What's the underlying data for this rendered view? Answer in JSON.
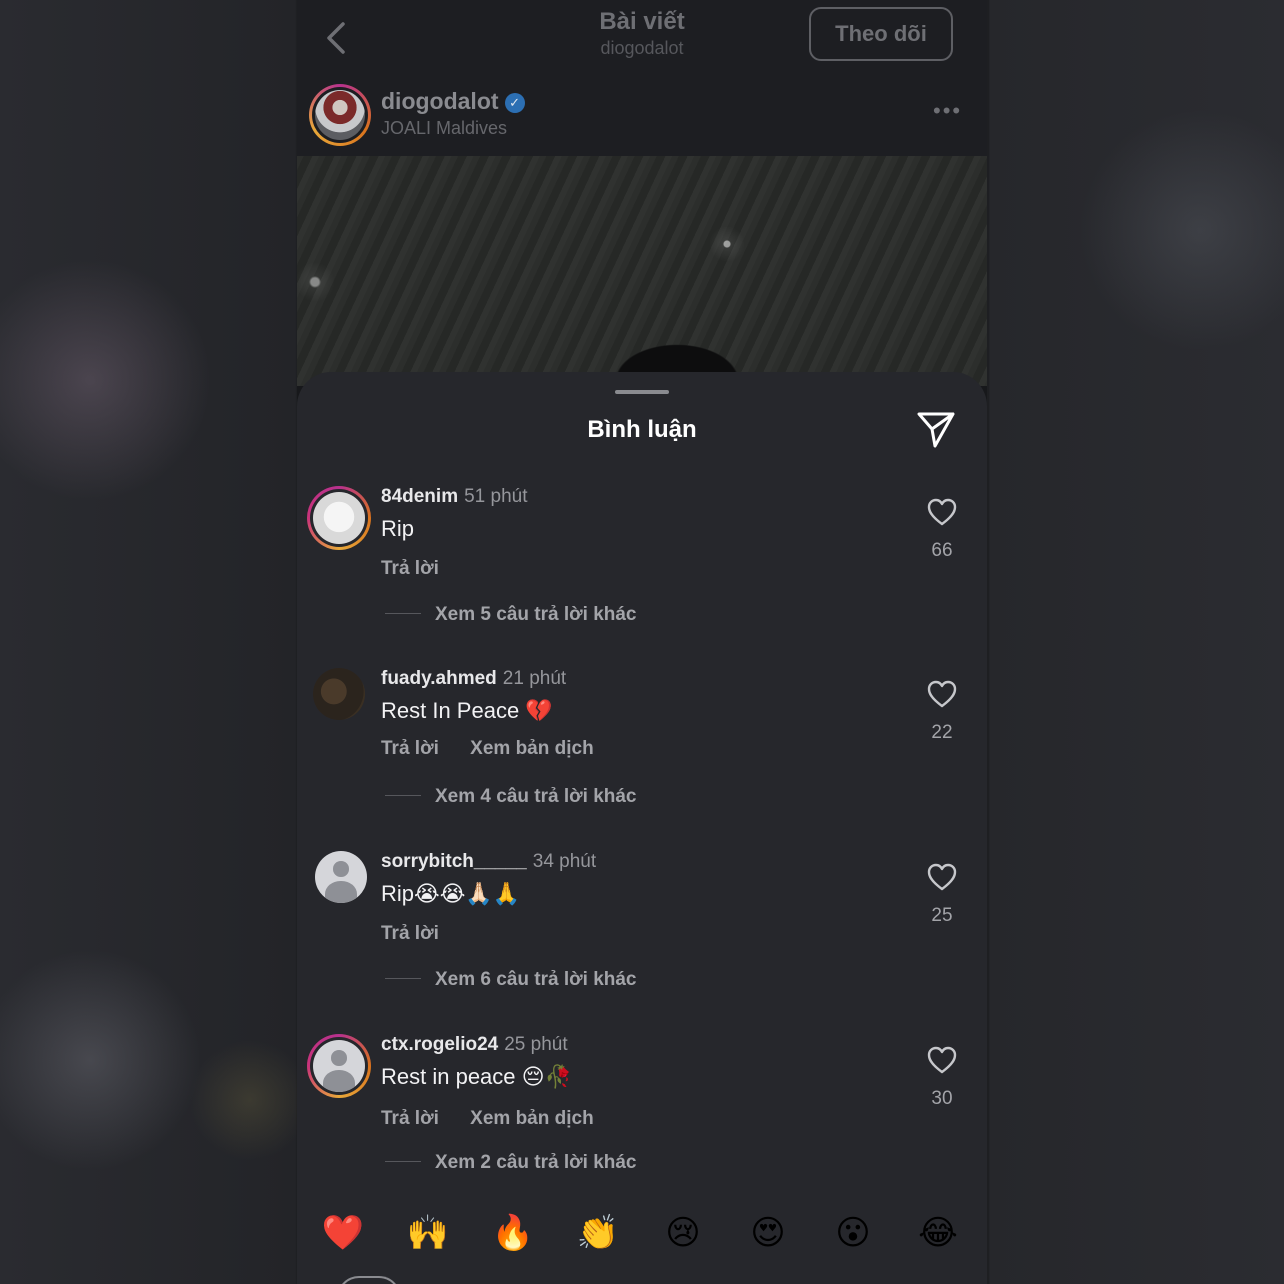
{
  "header": {
    "title": "Bài viết",
    "subtitle": "diogodalot",
    "follow_label": "Theo dõi"
  },
  "post": {
    "username": "diogodalot",
    "verified": true,
    "location": "JOALI Maldives",
    "more": "•••"
  },
  "comments_sheet": {
    "title": "Bình luận",
    "comments": [
      {
        "username": "84denim",
        "time": "51 phút",
        "text": "Rip",
        "reply_label": "Trả lời",
        "translate_label": "",
        "view_replies": "Xem 5 câu trả lời khác",
        "likes": "66"
      },
      {
        "username": "fuady.ahmed",
        "time": "21 phút",
        "text": "Rest In Peace 💔",
        "reply_label": "Trả lời",
        "translate_label": "Xem bản dịch",
        "view_replies": "Xem 4 câu trả lời khác",
        "likes": "22"
      },
      {
        "username": "sorrybitch_____",
        "time": "34 phút",
        "text": "Rip😭😭🙏🏻🙏",
        "reply_label": "Trả lời",
        "translate_label": "",
        "view_replies": "Xem 6 câu trả lời khác",
        "likes": "25"
      },
      {
        "username": "ctx.rogelio24",
        "time": "25 phút",
        "text": "Rest in peace 😔🥀",
        "reply_label": "Trả lời",
        "translate_label": "Xem bản dịch",
        "view_replies": "Xem 2 câu trả lời khác",
        "likes": "30"
      }
    ],
    "quick_reactions": [
      "❤️",
      "🙌",
      "🔥",
      "👏",
      "😢",
      "😍",
      "😮",
      "😂"
    ]
  },
  "icons": {
    "back": "chevron-left-icon",
    "send": "paper-plane-icon",
    "like": "heart-icon",
    "verified": "verified-badge-icon"
  },
  "colors": {
    "sheet_bg": "#26272c",
    "verified_blue": "#2c6fb3",
    "story_ring": "#d9731d"
  }
}
